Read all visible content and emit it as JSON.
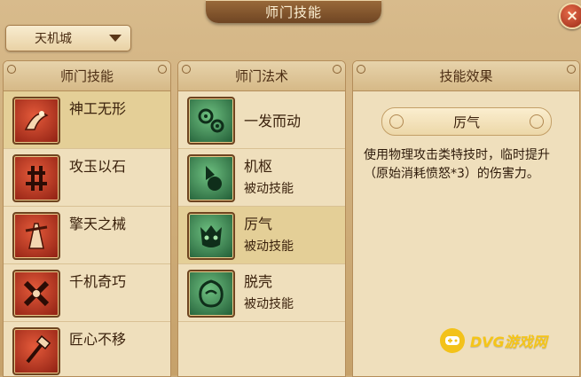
{
  "window": {
    "title": "师门技能",
    "close_label": "×"
  },
  "school_select": {
    "value": "天机城"
  },
  "panels": {
    "skills": {
      "header": "师门技能",
      "items": [
        {
          "label": "神工无形",
          "icon": "craft-swirl-icon",
          "selected": true
        },
        {
          "label": "攻玉以石",
          "icon": "stone-tool-icon",
          "selected": false
        },
        {
          "label": "擎天之械",
          "icon": "pillar-machine-icon",
          "selected": false
        },
        {
          "label": "千机奇巧",
          "icon": "cross-blades-icon",
          "selected": false
        },
        {
          "label": "匠心不移",
          "icon": "hammer-icon",
          "selected": false
        }
      ]
    },
    "spells": {
      "header": "师门法术",
      "items": [
        {
          "label": "一发而动",
          "sub": "",
          "icon": "gears-icon",
          "selected": false
        },
        {
          "label": "机枢",
          "sub": "被动技能",
          "icon": "orb-icon",
          "selected": false
        },
        {
          "label": "厉气",
          "sub": "被动技能",
          "icon": "demon-mask-icon",
          "selected": true
        },
        {
          "label": "脱壳",
          "sub": "被动技能",
          "icon": "shell-icon",
          "selected": false
        }
      ]
    },
    "effect": {
      "header": "技能效果",
      "skill_name": "厉气",
      "description": "使用物理攻击类特技时，临时提升（原始消耗愤怒*3）的伤害力。"
    }
  },
  "watermark": {
    "text": "DVG游戏网"
  },
  "colors": {
    "selected_row": "#e4cf97",
    "panel_bg": "#efdfbc",
    "accent_red": "#8d1f12",
    "accent_green": "#1f5a34"
  }
}
